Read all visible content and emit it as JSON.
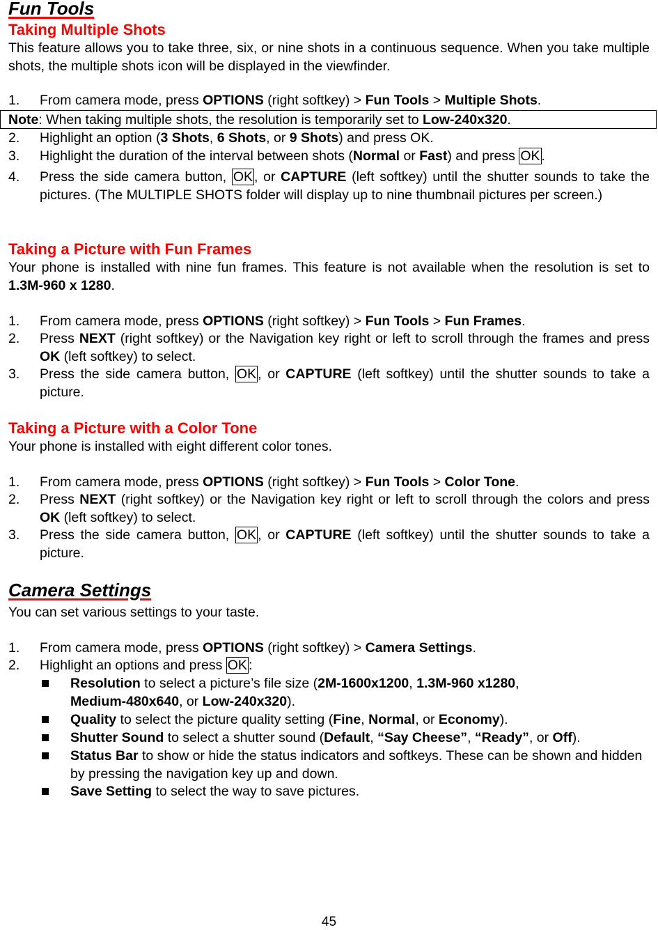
{
  "page": {
    "page_number": "45",
    "accent_color": "#ff0000"
  },
  "fun_tools": {
    "title": "Fun Tools",
    "multiple_shots": {
      "heading": "Taking Multiple Shots",
      "intro": "This feature allows you to take three, six, or nine shots in a continuous sequence. When you take multiple shots, the multiple shots icon will be displayed in the viewfinder.",
      "step1": {
        "num": "1.",
        "a": "From camera mode, press ",
        "b1": "OPTIONS",
        "c": " (right softkey) > ",
        "b2": "Fun Tools",
        "d": " > ",
        "b3": "Multiple Shots",
        "e": "."
      },
      "note": {
        "label": "Note",
        "a": ": When taking multiple shots, the resolution is temporarily set to ",
        "b": "Low-240x320",
        "c": "."
      },
      "step2": {
        "num": "2.",
        "a": "Highlight an option (",
        "b1": "3 Shots",
        "c": ", ",
        "b2": "6 Shots",
        "d": ", or ",
        "b3": "9 Shots",
        "e": ") and press OK."
      },
      "step3": {
        "num": "3.",
        "a": "Highlight the duration of the interval between shots (",
        "b1": "Normal",
        "c": " or ",
        "b2": "Fast",
        "d": ") and press ",
        "key": "OK",
        "e": "."
      },
      "step4": {
        "num": "4.",
        "a": "Press the side camera button, ",
        "key": "OK",
        "b": ", or ",
        "b1": "CAPTURE",
        "c": " (left softkey) until the shutter sounds to take the pictures. (The MULTIPLE SHOTS folder will display up to nine thumbnail pictures per screen.)"
      }
    },
    "fun_frames": {
      "heading": "Taking a Picture with Fun Frames",
      "intro_a": "Your phone is installed with nine fun frames. This feature is not available when the resolution is set to ",
      "intro_b": "1.3M-960 x 1280",
      "intro_c": ".",
      "step1": {
        "num": "1.",
        "a": "From camera mode, press ",
        "b1": "OPTIONS",
        "c": " (right softkey) > ",
        "b2": "Fun Tools",
        "d": " > ",
        "b3": "Fun Frames",
        "e": "."
      },
      "step2": {
        "num": "2.",
        "a": "Press ",
        "b1": "NEXT",
        "c": " (right softkey) or the Navigation key right or left to scroll through the frames and press ",
        "b2": "OK",
        "d": " (left softkey) to select."
      },
      "step3": {
        "num": "3.",
        "a": "Press the side camera button, ",
        "key": "OK",
        "b": ", or ",
        "b1": "CAPTURE",
        "c": " (left softkey) until the shutter sounds to take a picture."
      }
    },
    "color_tone": {
      "heading": "Taking a Picture with a Color Tone",
      "intro": "Your phone is installed with eight different color tones.",
      "step1": {
        "num": "1.",
        "a": "From camera mode, press ",
        "b1": "OPTIONS",
        "c": " (right softkey) > ",
        "b2": "Fun Tools",
        "d": " > ",
        "b3": "Color Tone",
        "e": "."
      },
      "step2": {
        "num": "2.",
        "a": "Press ",
        "b1": "NEXT",
        "c": " (right softkey) or the Navigation key right or left to scroll through the colors and press ",
        "b2": "OK",
        "d": " (left softkey) to select."
      },
      "step3": {
        "num": "3.",
        "a": "Press the side camera button, ",
        "key": "OK",
        "b": ", or ",
        "b1": "CAPTURE",
        "c": " (left softkey) until the shutter sounds to take a picture."
      }
    }
  },
  "camera_settings": {
    "title": "Camera Settings",
    "intro": "You can set various settings to your taste.",
    "step1": {
      "num": "1.",
      "a": "From camera mode, press ",
      "b1": "OPTIONS",
      "c": " (right softkey) > ",
      "b2": "Camera Settings",
      "d": "."
    },
    "step2": {
      "num": "2.",
      "a": "Highlight an options and press ",
      "key": "OK",
      "b": ":"
    },
    "bullets": [
      {
        "label": "Resolution",
        "a": " to select a picture’s file size (",
        "o1": "2M-1600x1200",
        "s1": ", ",
        "o2": "1.3M-960 x1280",
        "s2": ", ",
        "o3": "Medium-480x640",
        "s3": ", or ",
        "o4": "Low-240x320",
        "s4": ")."
      },
      {
        "label": "Quality",
        "a": " to select the picture quality setting (",
        "o1": "Fine",
        "s1": ", ",
        "o2": "Normal",
        "s2": ", or ",
        "o3": "Economy",
        "s3": ")."
      },
      {
        "label": "Shutter Sound",
        "a": " to select a shutter sound (",
        "o1": "Default",
        "s1": ", ",
        "o2": "“Say Cheese”",
        "s2": ", ",
        "o3": "“Ready”",
        "s3": ", or ",
        "o4": "Off",
        "s4": ")."
      },
      {
        "label": "Status Bar",
        "a": " to show or hide the status indicators and softkeys. These can be shown and hidden by pressing the navigation key up and down."
      },
      {
        "label": "Save Setting",
        "a": " to select the way to save pictures."
      }
    ]
  }
}
